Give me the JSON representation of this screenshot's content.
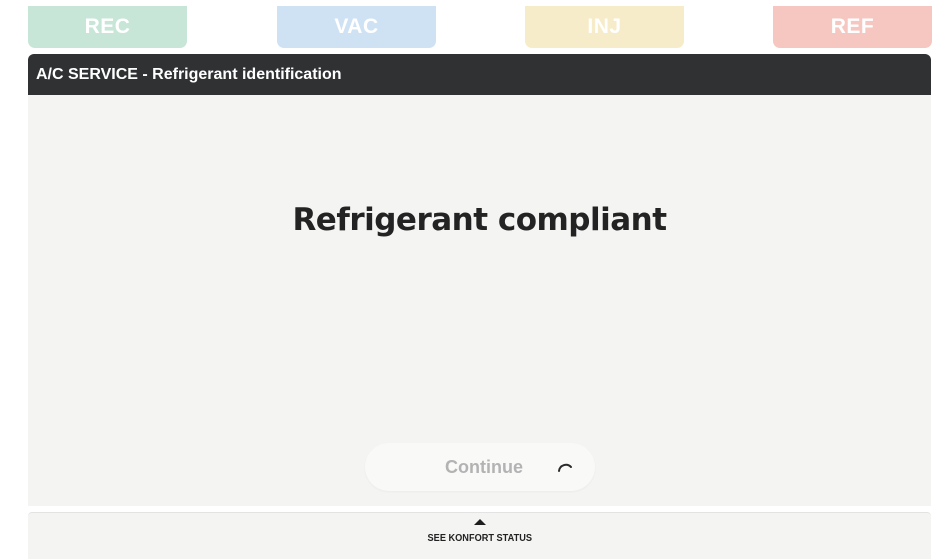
{
  "tabs": [
    {
      "label": "REC",
      "color": "#c8e6d8"
    },
    {
      "label": "VAC",
      "color": "#cfe2f4"
    },
    {
      "label": "INJ",
      "color": "#f7ecc9"
    },
    {
      "label": "REF",
      "color": "#f5c7c0"
    }
  ],
  "header": {
    "title": "A/C SERVICE - Refrigerant identification"
  },
  "main": {
    "message": "Refrigerant compliant",
    "continue_label": "Continue",
    "continue_icon": "spinner-icon"
  },
  "footer": {
    "label": "SEE KONFORT STATUS",
    "icon": "caret-up-icon"
  }
}
